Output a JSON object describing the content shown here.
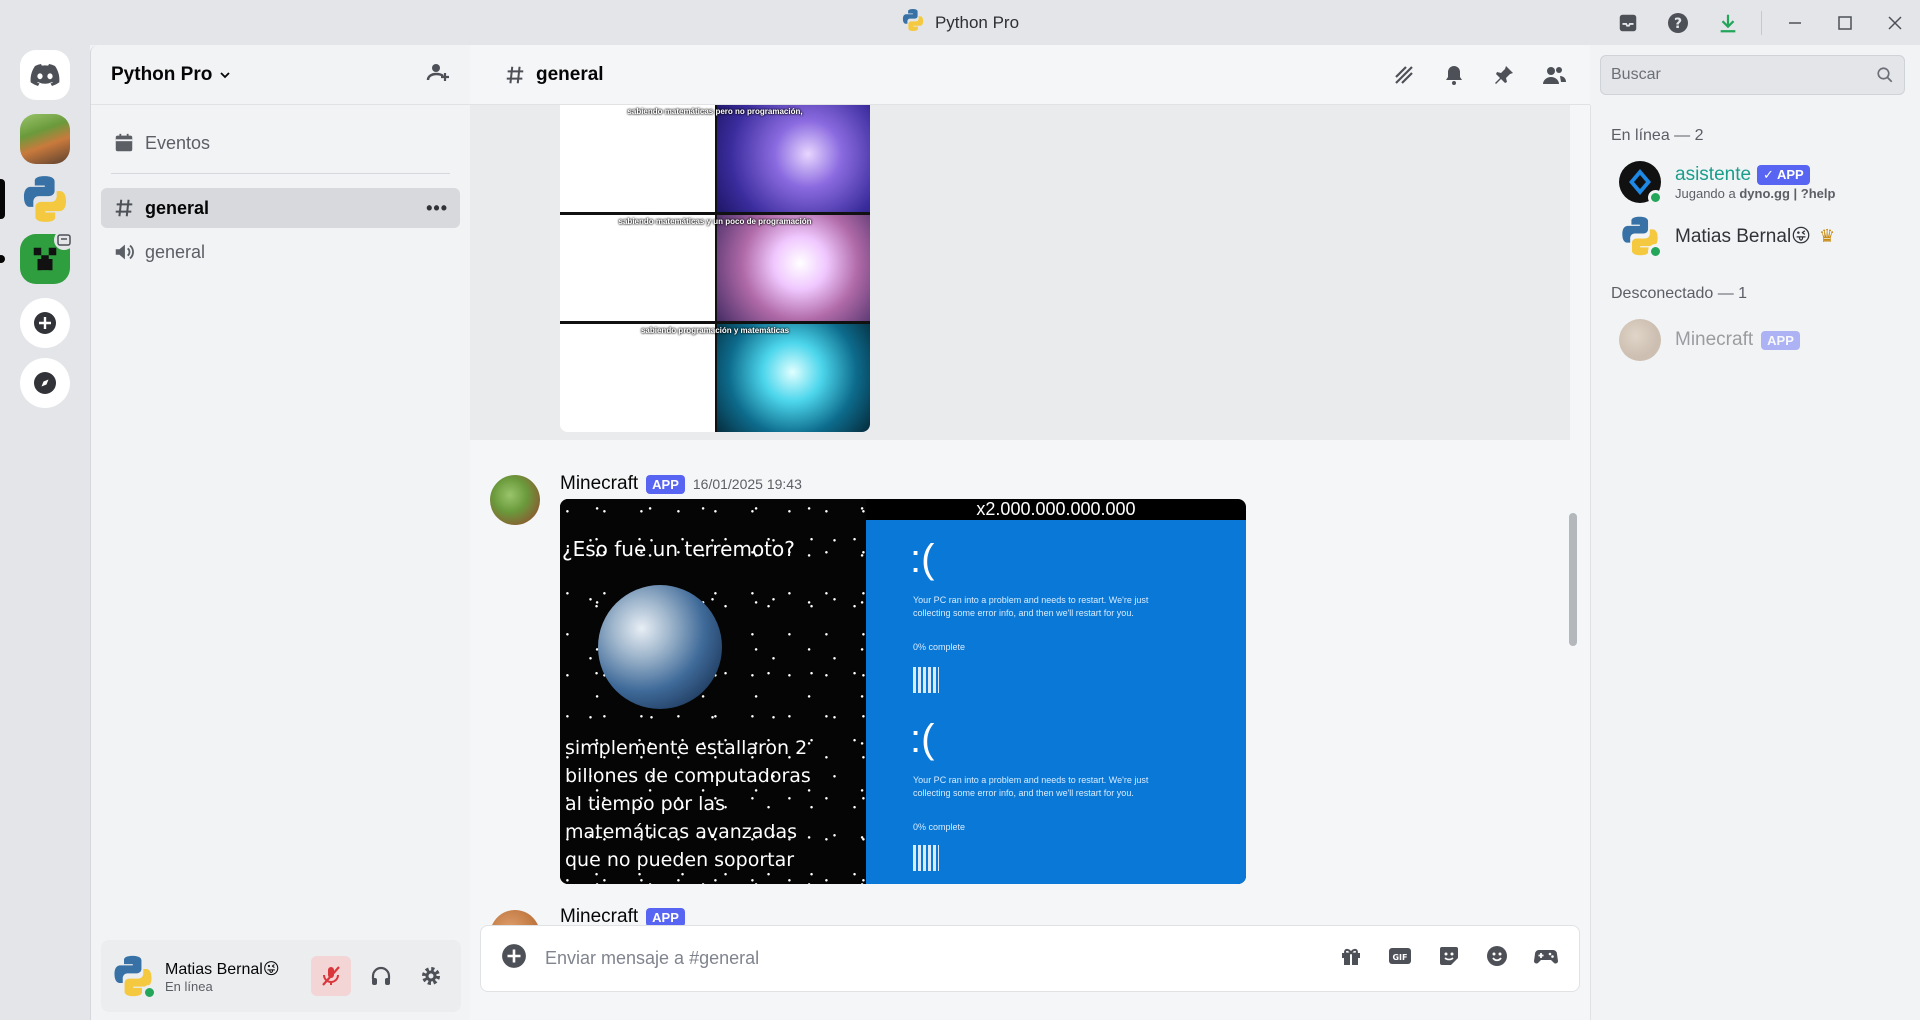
{
  "window": {
    "title": "Python Pro"
  },
  "server": {
    "name": "Python Pro"
  },
  "channels": {
    "events_label": "Eventos",
    "items": [
      {
        "name": "general",
        "type": "text",
        "active": true
      },
      {
        "name": "general",
        "type": "voice",
        "active": false
      }
    ]
  },
  "user": {
    "name": "Matias Bernal😜",
    "status": "En línea"
  },
  "header": {
    "channel": "general"
  },
  "search": {
    "placeholder": "Buscar"
  },
  "messages": {
    "meme1": {
      "captions": [
        "sabiendo matemáticas pero no programación,",
        "sabiendo matemáticas y un poco de programación",
        "sabiendo programación y matemáticas"
      ]
    },
    "msg2": {
      "author": "Minecraft",
      "badge": "APP",
      "timestamp": "16/01/2025 19:43",
      "image": {
        "counter": "x2.000.000.000.000",
        "question": "¿Eso fue un terremoto?",
        "caption_lines": [
          "simplemente estallaron 2",
          "billones de computadoras",
          "al tiempo por las",
          "matemáticas avanzadas",
          "que no pueden soportar"
        ],
        "bsod_face": ":(",
        "bsod_text": "Your PC ran into a problem and needs to restart. We're just collecting some error info, and then we'll restart for you.",
        "bsod_progress": "0% complete"
      }
    },
    "next_author": "Minecraft",
    "next_badge": "APP"
  },
  "composer": {
    "placeholder": "Enviar mensaje a #general"
  },
  "members": {
    "online_header": "En línea — 2",
    "online": [
      {
        "name": "asistente",
        "badge": "APP",
        "activity_prefix": "Jugando a ",
        "activity": "dyno.gg | ?help"
      },
      {
        "name": "Matias Bernal😜",
        "crown": "♛"
      }
    ],
    "offline_header": "Desconectado — 1",
    "offline": [
      {
        "name": "Minecraft",
        "badge": "APP"
      }
    ]
  },
  "colors": {
    "accent": "#5865f2",
    "online": "#23a55a",
    "bsod": "#0a78d7",
    "muted_red": "#da373c"
  }
}
